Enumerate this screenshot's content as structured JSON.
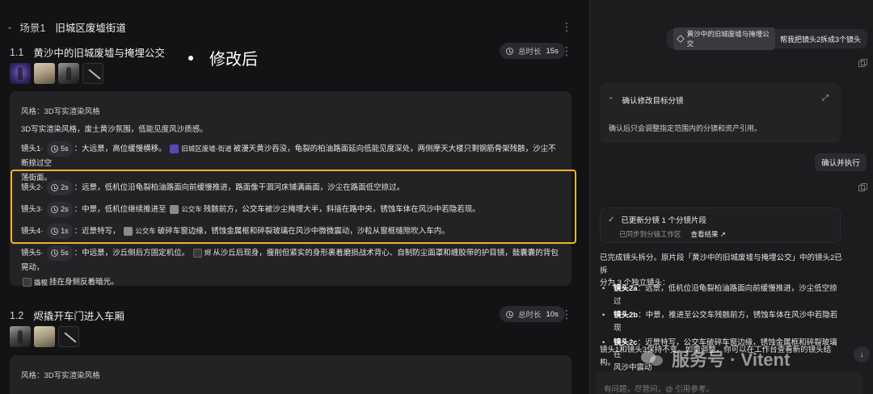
{
  "scene": {
    "label": "场景1",
    "title": "旧城区废墟街道"
  },
  "note": "修改后",
  "shot_groups": [
    {
      "num": "1.1",
      "title": "黄沙中的旧城废墟与掩埋公交",
      "duration_label": "总时长",
      "duration": "15s",
      "style_label": "风格：3D写实渲染风格",
      "style_desc": "3D写实渲染风格，废土黄沙氛围，低能见度风沙质感。",
      "shots": [
        {
          "label": "镜头1",
          "sep": "·",
          "dur": "5s",
          "pre": "：大远景，高位缓慢横移。",
          "chip": "旧城区废墟-街道",
          "post": "被漫天黄沙吞没，龟裂的柏油路面延向低能见度深处，两侧摩天大楼只剩钢筋骨架残骸，沙尘不断掠过空",
          "post2": "荡街面。"
        },
        {
          "label": "镜头2",
          "sep": "·",
          "dur": "2s",
          "text": "：远景，低机位沿龟裂柏油路面向前缓慢推进，路面像干涸河床铺满画面，沙尘在路面低空掠过。"
        },
        {
          "label": "镜头3",
          "sep": "·",
          "dur": "2s",
          "pre": "：中景，低机位继续推进至",
          "chip": "公交车",
          "post": "残骸前方，公交车被沙尘掩埋大半，斜插在路中央，锈蚀车体在风沙中若隐若现。"
        },
        {
          "label": "镜头4",
          "sep": "·",
          "dur": "1s",
          "pre": "：近景特写，",
          "chip": "公交车",
          "post": "破碎车窗边缘，锈蚀金属框和碎裂玻璃在风沙中微微震动，沙粒从窗框缝隙吹入车内。"
        },
        {
          "label": "镜头5",
          "sep": "·",
          "dur": "5s",
          "pre": "：中远景，沙丘侧后方固定机位。",
          "chip": "烬",
          "post": "从沙丘后现身，瘦削但紧实的身形裹着磨损战术背心、自制防尘面罩和缠胶带的护目镜，鼓囊囊的背包晃动，",
          "chip2": "撬棍",
          "post2": "挂在身侧反着暗光。"
        }
      ]
    },
    {
      "num": "1.2",
      "title": "烬撬开车门进入车厢",
      "duration_label": "总时长",
      "duration": "10s",
      "style_label": "风格：3D写实渲染风格"
    }
  ],
  "chat": {
    "user_ref_chip": "黄沙中的旧城废墟与掩埋公交",
    "user_text": "帮我把镜头2拆成3个镜头",
    "confirm_title": "确认修改目标分镜",
    "confirm_body": "确认后只会调整指定范围内的分镜和资产引用。",
    "execute_button": "确认并执行",
    "update_title": "已更新分镜 1 个分镜片段",
    "update_sub": "已同步到分镜工作区",
    "update_link": "查看结果 ↗",
    "reply_intro_1": "已完成镜头拆分。原片段「黄沙中的旧城废墟与掩埋公交」中的镜头2已拆",
    "reply_intro_2": "分为 3 个独立镜头：",
    "items": [
      {
        "key": "镜头2a",
        "text": "：远景，低机位沿龟裂柏油路面向前缓慢推进，沙尘低空掠过"
      },
      {
        "key": "镜头2b",
        "text": "：中景，推进至公交车残骸前方，锈蚀车体在风沙中若隐若现"
      },
      {
        "key": "镜头2c",
        "text": "：近景特写，公交车破碎车窗边缘，锈蚀金属框和碎裂玻璃在",
        "text2": "风沙中震动"
      }
    ],
    "reply_outro_1": "镜头1和镜头3保持不变。如需调整，你可以在工作台查看新的镜头结",
    "reply_outro_2": "构。",
    "input_placeholder": "有问题，尽管问，@ 引用参考。"
  },
  "watermark": "服务号 · Vitent"
}
